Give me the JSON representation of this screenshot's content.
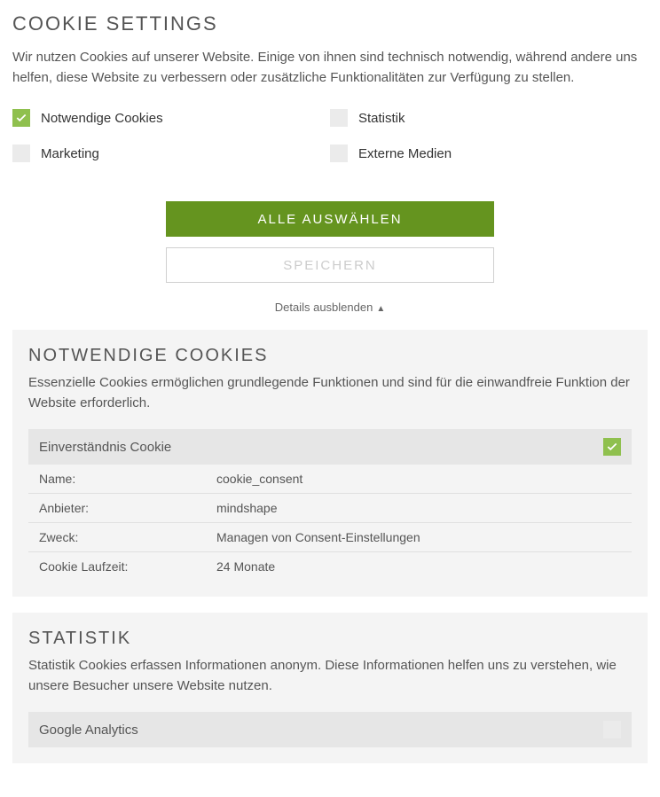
{
  "title": "COOKIE SETTINGS",
  "intro": "Wir nutzen Cookies auf unserer Website. Einige von ihnen sind technisch notwendig, während andere uns helfen, diese Website zu verbessern oder zusätzliche Funktionalitäten zur Verfügung zu stellen.",
  "options": {
    "necessary": {
      "label": "Notwendige Cookies",
      "checked": true
    },
    "statistics": {
      "label": "Statistik",
      "checked": false
    },
    "marketing": {
      "label": "Marketing",
      "checked": false
    },
    "external": {
      "label": "Externe Medien",
      "checked": false
    }
  },
  "buttons": {
    "select_all": "ALLE AUSWÄHLEN",
    "save": "SPEICHERN"
  },
  "toggle_details": "Details ausblenden",
  "sections": {
    "necessary": {
      "title": "NOTWENDIGE COOKIES",
      "desc": "Essenzielle Cookies ermöglichen grundlegende Funktionen und sind für die einwandfreie Funktion der Website erforderlich.",
      "cookie": {
        "title": "Einverständnis Cookie",
        "checked": true,
        "rows": {
          "name_key": "Name:",
          "name_val": "cookie_consent",
          "provider_key": "Anbieter:",
          "provider_val": "mindshape",
          "purpose_key": "Zweck:",
          "purpose_val": "Managen von Consent-Einstellungen",
          "duration_key": "Cookie Laufzeit:",
          "duration_val": "24 Monate"
        }
      }
    },
    "statistics": {
      "title": "STATISTIK",
      "desc": "Statistik Cookies erfassen Informationen anonym. Diese Informationen helfen uns zu verstehen, wie unsere Besucher unsere Website nutzen.",
      "cookie": {
        "title": "Google Analytics",
        "checked": false
      }
    }
  }
}
